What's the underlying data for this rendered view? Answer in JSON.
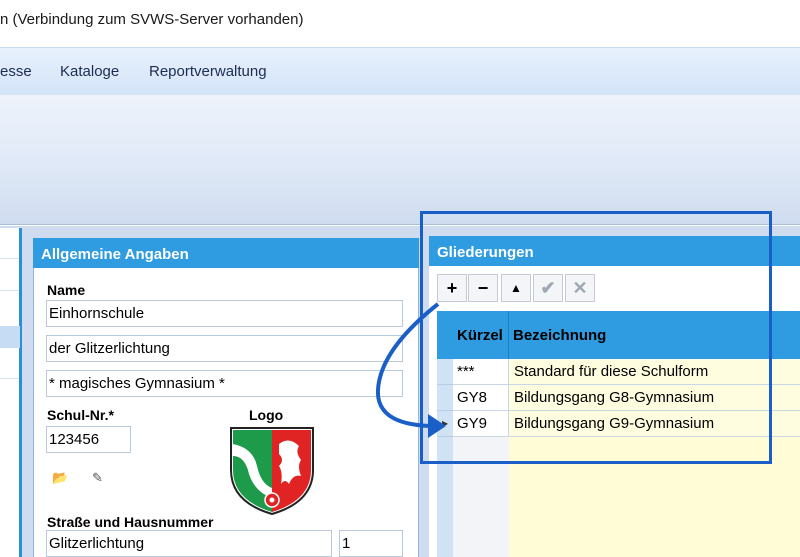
{
  "window": {
    "title": "n (Verbindung zum SVWS-Server vorhanden)"
  },
  "menu": {
    "items": [
      "esse",
      "Kataloge",
      "Reportverwaltung"
    ]
  },
  "left_panel": {
    "title": "Allgemeine Angaben",
    "name_label": "Name",
    "name_line1": "Einhornschule",
    "name_line2": "der Glitzerlichtung",
    "name_line3": "* magisches Gymnasium *",
    "schulnr_label": "Schul-Nr.*",
    "schulnr_value": "123456",
    "logo_label": "Logo",
    "street_label": "Straße und Hausnummer",
    "street_value": "Glitzerlichtung",
    "house_number": "1"
  },
  "right_panel": {
    "title": "Gliederungen",
    "toolbar": {
      "add": "+",
      "remove": "−",
      "up": "▲",
      "confirm": "✔",
      "cancel": "✕"
    },
    "columns": [
      "Kürzel",
      "Bezeichnung"
    ],
    "rows": [
      {
        "kuerzel": "***",
        "bezeichnung": "Standard für diese Schulform"
      },
      {
        "kuerzel": "GY8",
        "bezeichnung": "Bildungsgang G8-Gymnasium"
      },
      {
        "kuerzel": "GY9",
        "bezeichnung": "Bildungsgang G9-Gymnasium"
      }
    ]
  },
  "colors": {
    "panel_header": "#2f9be0",
    "highlight": "#1a5fc8",
    "row_yellow": "#fffde0"
  }
}
